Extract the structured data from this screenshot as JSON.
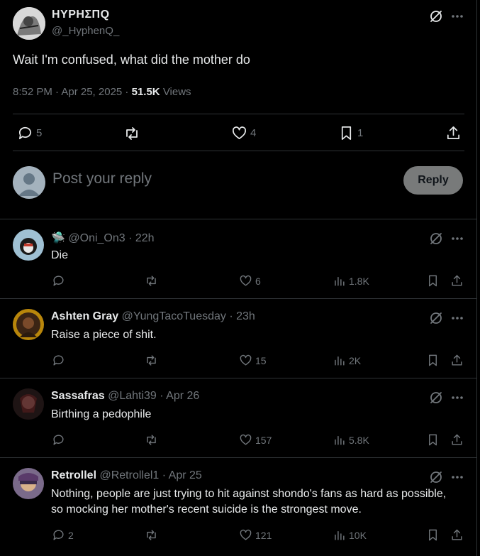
{
  "tweet": {
    "author_name": "ΗΥΡΗΣΠQ",
    "author_handle": "@_HyphenQ_",
    "text": "Wait I'm confused, what did the mother do",
    "timestamp": "8:52 PM · Apr 25, 2025 ·",
    "views_count": "51.5K",
    "views_label": "Views",
    "stats": {
      "replies": "5",
      "likes": "4",
      "bookmarks": "1"
    }
  },
  "composer": {
    "placeholder": "Post your reply",
    "button_label": "Reply"
  },
  "replies": [
    {
      "name": "",
      "badge": "🛸",
      "handle": "@Oni_On3",
      "time": "· 22h",
      "text": "Die",
      "replies": "",
      "likes": "6",
      "views": "1.8K",
      "avatar_color": "#8fb3c7"
    },
    {
      "name": "Ashten Gray",
      "badge": "",
      "handle": "@YungTacoTuesday",
      "time": "· 23h",
      "text": "Raise a piece of shit.",
      "replies": "",
      "likes": "15",
      "views": "2K",
      "avatar_color": "#5a3a1a"
    },
    {
      "name": "Sassafras",
      "badge": "",
      "handle": "@Lahti39",
      "time": "· Apr 26",
      "text": "Birthing a pedophile",
      "replies": "",
      "likes": "157",
      "views": "5.8K",
      "avatar_color": "#3a2a2a"
    },
    {
      "name": "Retrollel",
      "badge": "",
      "handle": "@Retrollel1",
      "time": "· Apr 25",
      "text": "Nothing, people are just trying to hit against shondo's fans as hard as possible, so mocking her mother's recent suicide is the strongest move.",
      "replies": "2",
      "likes": "121",
      "views": "10K",
      "avatar_color": "#6a5a7a"
    }
  ]
}
